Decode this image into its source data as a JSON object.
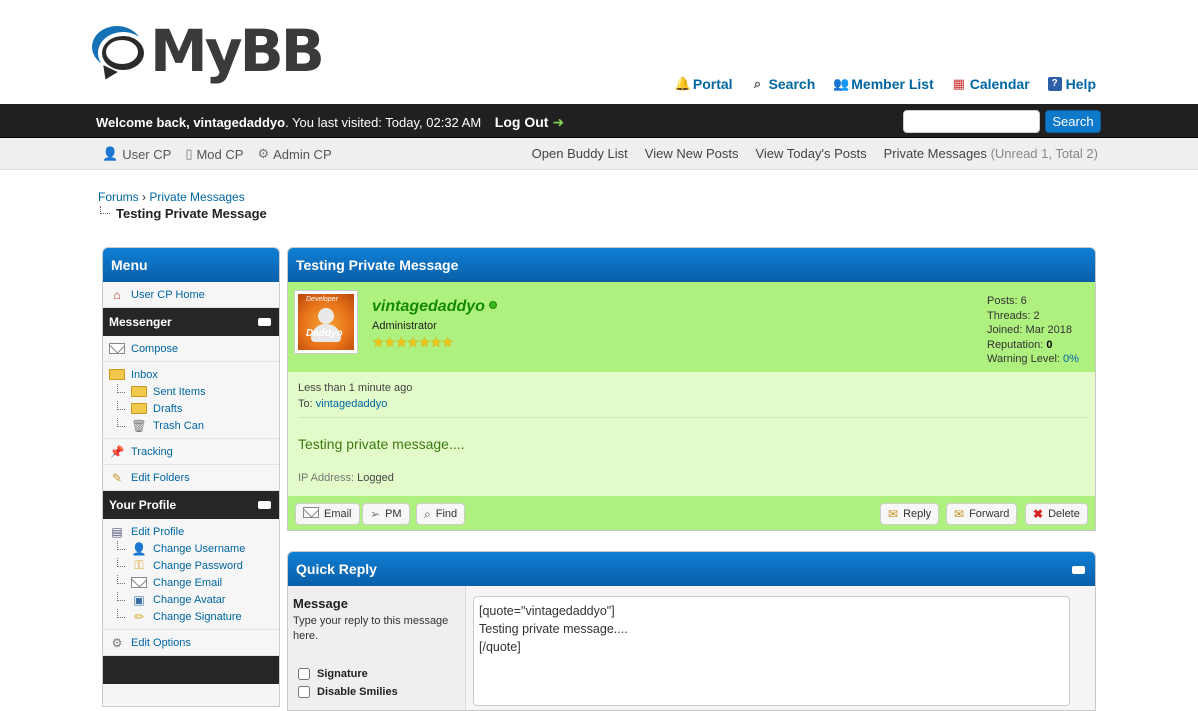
{
  "logo": {
    "text": "MyBB"
  },
  "toplinks": [
    {
      "label": "Portal",
      "icon": "bell-icon"
    },
    {
      "label": "Search",
      "icon": "magnifier-icon"
    },
    {
      "label": "Member List",
      "icon": "members-icon"
    },
    {
      "label": "Calendar",
      "icon": "calendar-icon"
    },
    {
      "label": "Help",
      "icon": "help-icon"
    }
  ],
  "panel": {
    "welcome_prefix": "Welcome back,",
    "username": "vintagedaddyo",
    "last_visit": ". You last visited: Today, 02:32 AM",
    "logout": "Log Out",
    "search_button": "Search"
  },
  "subnav": {
    "left": [
      "User CP",
      "Mod CP",
      "Admin CP"
    ],
    "right": [
      "Open Buddy List",
      "View New Posts",
      "View Today's Posts",
      "Private Messages"
    ],
    "pm_count": "(Unread 1, Total 2)"
  },
  "breadcrumb": {
    "items": [
      "Forums",
      "Private Messages"
    ],
    "separator": "›",
    "current": "Testing Private Message"
  },
  "menu": {
    "title": "Menu",
    "home": "User CP Home",
    "messenger": {
      "title": "Messenger",
      "compose": "Compose",
      "inbox": "Inbox",
      "sent": "Sent Items",
      "drafts": "Drafts",
      "trash": "Trash Can",
      "tracking": "Tracking",
      "edit_folders": "Edit Folders"
    },
    "profile": {
      "title": "Your Profile",
      "edit_profile": "Edit Profile",
      "change_username": "Change Username",
      "change_password": "Change Password",
      "change_email": "Change Email",
      "change_avatar": "Change Avatar",
      "change_signature": "Change Signature",
      "edit_options": "Edit Options"
    }
  },
  "pm": {
    "title": "Testing Private Message",
    "author": {
      "name": "vintagedaddyo",
      "usertitle": "Administrator",
      "stars": "★★★★★★★",
      "avatar_text_top": "Developer",
      "avatar_text_bottom": "Daddyo"
    },
    "stats": {
      "posts_label": "Posts:",
      "posts": "6",
      "threads_label": "Threads:",
      "threads": "2",
      "joined_label": "Joined:",
      "joined": "Mar 2018",
      "reputation_label": "Reputation:",
      "reputation": "0",
      "warning_label": "Warning Level:",
      "warning": "0%"
    },
    "date": "Less than 1 minute ago",
    "to_label": "To:",
    "to": "vintagedaddyo",
    "message": "Testing private message....",
    "ip_label": "IP Address:",
    "ip": "Logged",
    "buttons": {
      "email": "Email",
      "pm": "PM",
      "find": "Find",
      "reply": "Reply",
      "forward": "Forward",
      "delete": "Delete"
    }
  },
  "quick_reply": {
    "title": "Quick Reply",
    "label": "Message",
    "hint": "Type your reply to this message here.",
    "options": [
      "Signature",
      "Disable Smilies"
    ],
    "text": "[quote=\"vintagedaddyo\"]\nTesting private message....\n[/quote]"
  },
  "colors": {
    "brand_blue": "#0a6cc0",
    "dark_bar": "#202020",
    "author_green": "#aff17f",
    "body_green": "#e3fbc9",
    "link": "#0066a2"
  }
}
